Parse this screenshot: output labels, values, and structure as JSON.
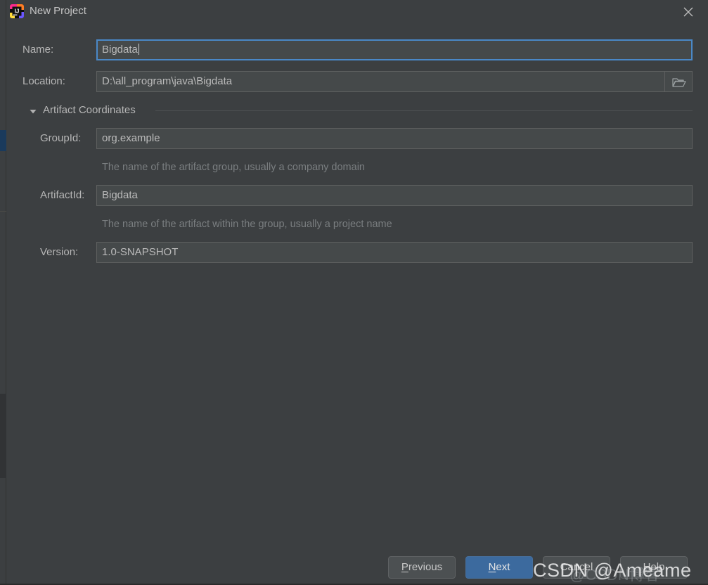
{
  "window": {
    "title": "New Project",
    "app_icon": "intellij-idea-icon",
    "close_icon": "close-icon"
  },
  "form": {
    "name": {
      "label": "Name:",
      "value": "Bigdata",
      "focused": true
    },
    "location": {
      "label": "Location:",
      "value": "D:\\all_program\\java\\Bigdata",
      "browse_icon": "folder-icon"
    }
  },
  "artifact_section": {
    "title": "Artifact Coordinates",
    "expanded": true,
    "arrow_icon": "chevron-down-icon",
    "fields": [
      {
        "label": "GroupId:",
        "value": "org.example",
        "hint": "The name of the artifact group, usually a company domain"
      },
      {
        "label": "ArtifactId:",
        "value": "Bigdata",
        "hint": "The name of the artifact within the group, usually a project name"
      },
      {
        "label": "Version:",
        "value": "1.0-SNAPSHOT",
        "hint": ""
      }
    ]
  },
  "buttons": {
    "previous": {
      "label": "Previous",
      "mnemonic": "P"
    },
    "next": {
      "label": "Next",
      "mnemonic": "N",
      "default": true
    },
    "cancel": {
      "label": "Cancel"
    },
    "help": {
      "label": "Help"
    }
  },
  "watermark": {
    "text": "CSDN @Ameame",
    "ghost_text": "@CSDN博客"
  },
  "colors": {
    "dialog_background": "#3c3f41",
    "field_background": "#45494a",
    "focus_border": "#4a88c7",
    "default_button": "#3c6a9e",
    "text": "#bbbbbb",
    "hint_text": "#7a7e80"
  }
}
